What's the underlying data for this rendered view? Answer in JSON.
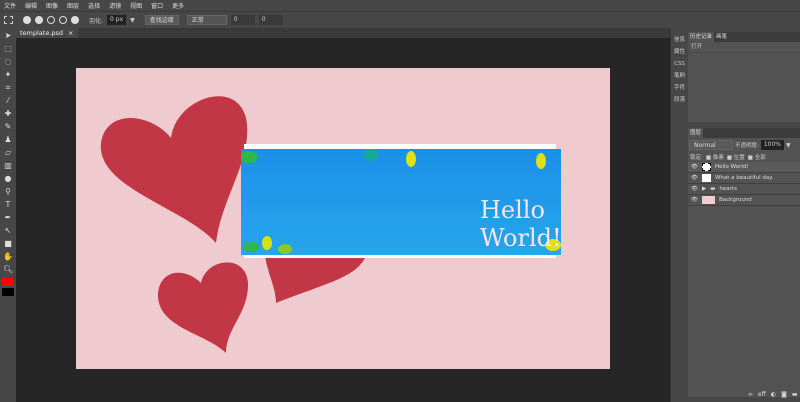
{
  "menu": [
    "文件",
    "编辑",
    "图像",
    "图层",
    "选择",
    "滤镜",
    "视图",
    "窗口",
    "更多"
  ],
  "toolbar": {
    "feather_label": "羽化:",
    "feather_value": "0 px",
    "refine_label": "查找边缘",
    "style_value": "正常",
    "w_value": "0",
    "h_value": "0"
  },
  "document": {
    "tab": "template.psd",
    "close": "×",
    "canvas_text": "Hello World!"
  },
  "minipanels": [
    "信息",
    "属性",
    "CSS",
    "笔刷",
    "字符",
    "段落"
  ],
  "history": {
    "tabs": [
      "历史记录",
      "画笔"
    ],
    "items": [
      "打开"
    ]
  },
  "layers": {
    "tab": "图层",
    "blend": "Normal",
    "opacity_label": "不透明度:",
    "opacity": "100%",
    "lock_label": "锁定:",
    "lock_options": [
      "像素",
      "位置",
      "全部"
    ],
    "items": [
      {
        "name": "Hello World!",
        "type": "text",
        "selected": true
      },
      {
        "name": "What a beautiful day.",
        "type": "text"
      },
      {
        "name": "hearts",
        "type": "folder"
      },
      {
        "name": "Background",
        "type": "image"
      }
    ]
  },
  "colors": {
    "foreground": "#ff0000",
    "background": "#000000",
    "heart": "#c13745",
    "canvas": "#efcbcf"
  },
  "footer_icons": [
    "link-icon",
    "fx-icon",
    "adjustment-icon",
    "mask-icon",
    "folder-icon",
    "new-layer-icon",
    "trash-icon"
  ]
}
